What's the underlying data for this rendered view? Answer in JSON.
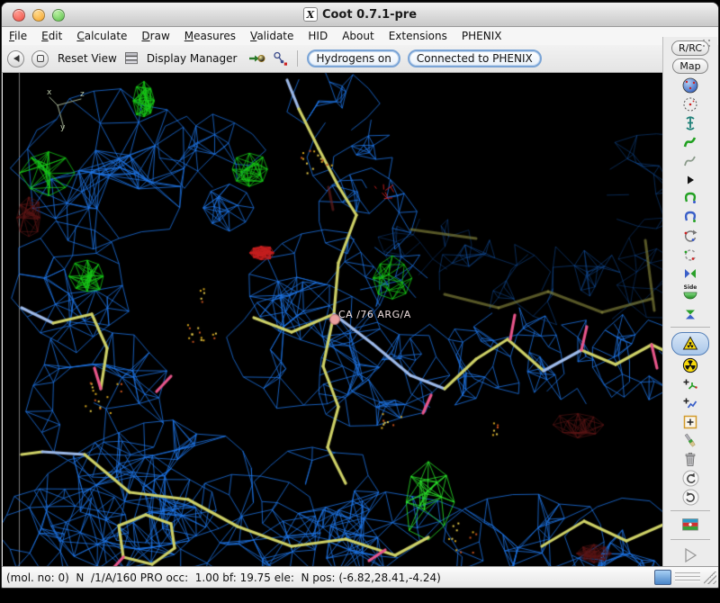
{
  "window": {
    "title": "Coot 0.7.1-pre",
    "x11_badge": "X"
  },
  "menu": {
    "items": [
      {
        "label": "File",
        "u": 0
      },
      {
        "label": "Edit",
        "u": 0
      },
      {
        "label": "Calculate",
        "u": 0
      },
      {
        "label": "Draw",
        "u": 0
      },
      {
        "label": "Measures",
        "u": 0
      },
      {
        "label": "Validate",
        "u": 0
      },
      {
        "label": "HID",
        "u": -1
      },
      {
        "label": "About",
        "u": -1
      },
      {
        "label": "Extensions",
        "u": -1
      },
      {
        "label": "PHENIX",
        "u": -1
      }
    ]
  },
  "toolbar": {
    "reset_view": "Reset View",
    "display_manager": "Display Manager",
    "hydrogens": "Hydrogens on",
    "phenix": "Connected to PHENIX"
  },
  "side_toolbar": {
    "rrc": "R/RC",
    "map": "Map",
    "side_label": "Side"
  },
  "canvas": {
    "atom_label": "CA /76 ARG/A",
    "axes": {
      "x": "x",
      "y": "y",
      "z": "z"
    }
  },
  "status_bar": {
    "text": "(mol. no: 0)  N  /1/A/160 PRO occ:  1.00 bf: 19.75 ele:  N pos: (-6.82,28.41,-4.24)"
  },
  "colors": {
    "mesh_blue": "#1e76e8",
    "mesh_dim": "#124f9e",
    "diff_green": "#16c816",
    "diff_green_bright": "#2be82b",
    "diff_red": "#c41e1e",
    "diff_red_dark": "#5a1414",
    "stick_yellow": "#cdd066",
    "stick_blue": "#9db9e8",
    "stick_dim": "#85853c",
    "stick_pink": "#e8558a",
    "axes": "#a8b698",
    "accent": "#7aa4d6"
  }
}
